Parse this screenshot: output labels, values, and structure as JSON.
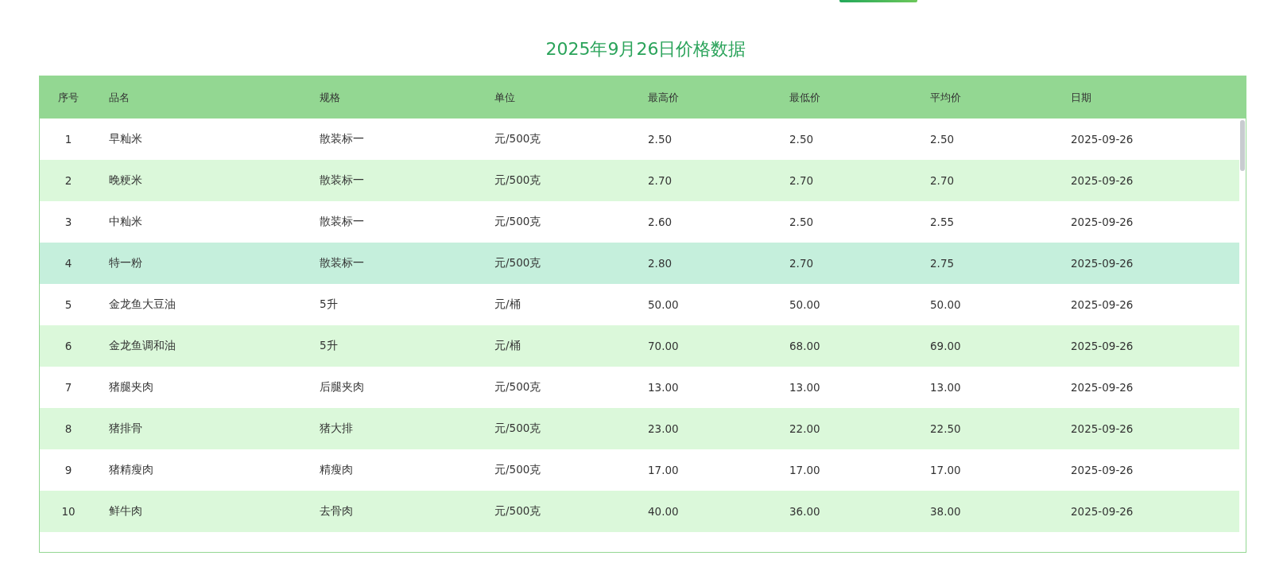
{
  "title": "2025年9月26日价格数据",
  "table": {
    "columns": [
      "序号",
      "品名",
      "规格",
      "单位",
      "最高价",
      "最低价",
      "平均价",
      "日期"
    ],
    "rows": [
      {
        "cells": [
          "1",
          "早籼米",
          "散装标一",
          "元/500克",
          "2.50",
          "2.50",
          "2.50",
          "2025-09-26"
        ],
        "selected": false
      },
      {
        "cells": [
          "2",
          "晚粳米",
          "散装标一",
          "元/500克",
          "2.70",
          "2.70",
          "2.70",
          "2025-09-26"
        ],
        "selected": false
      },
      {
        "cells": [
          "3",
          "中籼米",
          "散装标一",
          "元/500克",
          "2.60",
          "2.50",
          "2.55",
          "2025-09-26"
        ],
        "selected": false
      },
      {
        "cells": [
          "4",
          "特一粉",
          "散装标一",
          "元/500克",
          "2.80",
          "2.70",
          "2.75",
          "2025-09-26"
        ],
        "selected": true
      },
      {
        "cells": [
          "5",
          "金龙鱼大豆油",
          "5升",
          "元/桶",
          "50.00",
          "50.00",
          "50.00",
          "2025-09-26"
        ],
        "selected": false
      },
      {
        "cells": [
          "6",
          "金龙鱼调和油",
          "5升",
          "元/桶",
          "70.00",
          "68.00",
          "69.00",
          "2025-09-26"
        ],
        "selected": false
      },
      {
        "cells": [
          "7",
          "猪腿夹肉",
          "后腿夹肉",
          "元/500克",
          "13.00",
          "13.00",
          "13.00",
          "2025-09-26"
        ],
        "selected": false
      },
      {
        "cells": [
          "8",
          "猪排骨",
          "猪大排",
          "元/500克",
          "23.00",
          "22.00",
          "22.50",
          "2025-09-26"
        ],
        "selected": false
      },
      {
        "cells": [
          "9",
          "猪精瘦肉",
          "精瘦肉",
          "元/500克",
          "17.00",
          "17.00",
          "17.00",
          "2025-09-26"
        ],
        "selected": false
      },
      {
        "cells": [
          "10",
          "鲜牛肉",
          "去骨肉",
          "元/500克",
          "40.00",
          "36.00",
          "38.00",
          "2025-09-26"
        ],
        "selected": false
      }
    ]
  }
}
